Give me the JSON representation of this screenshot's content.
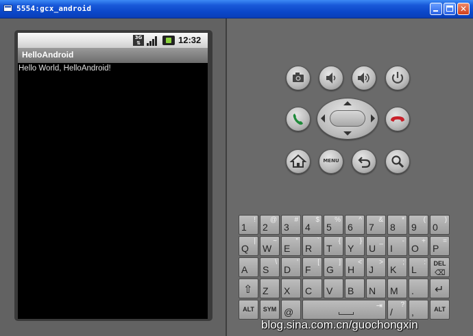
{
  "window": {
    "title": "5554:gcx_android"
  },
  "status_bar": {
    "network": "3G",
    "clock": "12:32"
  },
  "app": {
    "title": "HelloAndroid",
    "content_text": "Hello World, HelloAndroid!"
  },
  "controls": {
    "menu_label": "MENU",
    "top_row": [
      "camera-icon",
      "volume-down-icon",
      "volume-up-icon",
      "power-icon"
    ],
    "mid_row": [
      "call-icon",
      "dpad",
      "end-call-icon"
    ],
    "bottom_row": [
      "home-icon",
      "menu-button",
      "back-icon",
      "search-icon"
    ]
  },
  "keyboard": {
    "rows": [
      [
        {
          "main": "1",
          "alt": "!"
        },
        {
          "main": "2",
          "alt": "@"
        },
        {
          "main": "3",
          "alt": "#"
        },
        {
          "main": "4",
          "alt": "$"
        },
        {
          "main": "5",
          "alt": "%"
        },
        {
          "main": "6",
          "alt": "^"
        },
        {
          "main": "7",
          "alt": "&"
        },
        {
          "main": "8",
          "alt": "*"
        },
        {
          "main": "9",
          "alt": "("
        },
        {
          "main": "0",
          "alt": ")"
        }
      ],
      [
        {
          "main": "Q",
          "alt": "|"
        },
        {
          "main": "W",
          "alt": "~"
        },
        {
          "main": "E",
          "alt": "\""
        },
        {
          "main": "R",
          "alt": "`"
        },
        {
          "main": "T",
          "alt": "{"
        },
        {
          "main": "Y",
          "alt": "}"
        },
        {
          "main": "U",
          "alt": "_"
        },
        {
          "main": "I",
          "alt": "-"
        },
        {
          "main": "O",
          "alt": "+"
        },
        {
          "main": "P",
          "alt": "="
        }
      ],
      [
        {
          "main": "A",
          "alt": ""
        },
        {
          "main": "S",
          "alt": "\\"
        },
        {
          "main": "D",
          "alt": "'"
        },
        {
          "main": "F",
          "alt": "["
        },
        {
          "main": "G",
          "alt": "]"
        },
        {
          "main": "H",
          "alt": "<"
        },
        {
          "main": "J",
          "alt": ">"
        },
        {
          "main": "K",
          "alt": ";"
        },
        {
          "main": "L",
          "alt": ":"
        },
        {
          "main": "DEL",
          "alt": ""
        }
      ],
      [
        {
          "main": "⇧",
          "alt": ""
        },
        {
          "main": "Z",
          "alt": ""
        },
        {
          "main": "X",
          "alt": ""
        },
        {
          "main": "C",
          "alt": ""
        },
        {
          "main": "V",
          "alt": ""
        },
        {
          "main": "B",
          "alt": ""
        },
        {
          "main": "N",
          "alt": ""
        },
        {
          "main": "M",
          "alt": ""
        },
        {
          "main": ".",
          "alt": ""
        },
        {
          "main": "↵",
          "alt": ""
        }
      ],
      [
        {
          "main": "ALT",
          "alt": ""
        },
        {
          "main": "SYM",
          "alt": ""
        },
        {
          "main": "@",
          "alt": ""
        },
        {
          "main": "",
          "alt": ""
        },
        {
          "main": "/",
          "alt": "?"
        },
        {
          "main": ",",
          "alt": ""
        },
        {
          "main": "ALT",
          "alt": ""
        }
      ]
    ]
  },
  "watermark": "blog.sina.com.cn/guochongxin"
}
